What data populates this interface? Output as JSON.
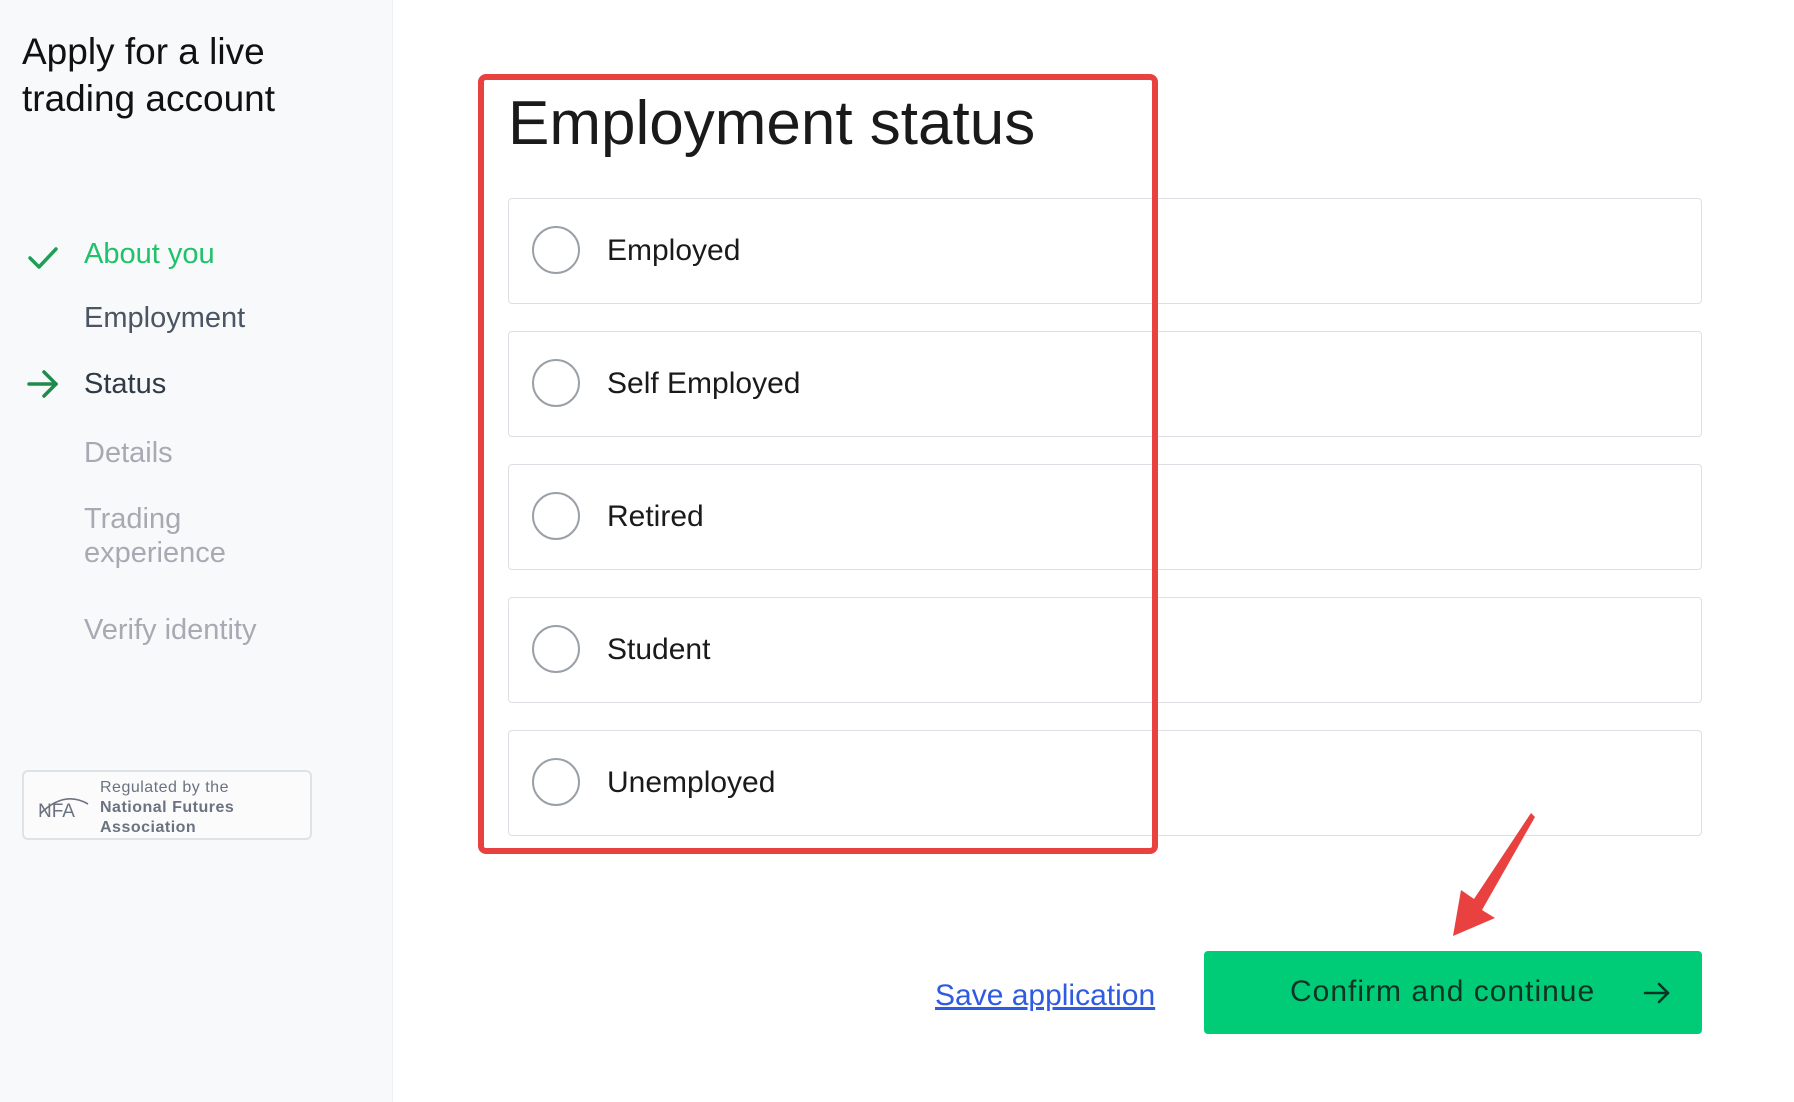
{
  "sidebar": {
    "title": "Apply for a live trading account",
    "nav": [
      {
        "label": "About you",
        "state": "done",
        "icon": "check-icon"
      },
      {
        "label": "Employment",
        "state": "section"
      },
      {
        "label": "Status",
        "state": "current",
        "icon": "arrow-right-icon"
      },
      {
        "label": "Details",
        "state": "future"
      },
      {
        "label": "Trading experience",
        "state": "future"
      },
      {
        "label": "Verify identity",
        "state": "future"
      }
    ],
    "badge": {
      "logo": "NFA",
      "line1": "Regulated by the",
      "line2": "National Futures",
      "line3": "Association"
    }
  },
  "main": {
    "heading": "Employment status",
    "options": [
      {
        "label": "Employed",
        "selected": false
      },
      {
        "label": "Self Employed",
        "selected": false
      },
      {
        "label": "Retired",
        "selected": false
      },
      {
        "label": "Student",
        "selected": false
      },
      {
        "label": "Unemployed",
        "selected": false
      }
    ],
    "save_link": "Save application",
    "confirm_button": "Confirm and continue"
  },
  "colors": {
    "accent_green": "#00cc77",
    "done_green": "#1fc26a",
    "link_blue": "#2f5be0",
    "annotation_red": "#e94040"
  }
}
